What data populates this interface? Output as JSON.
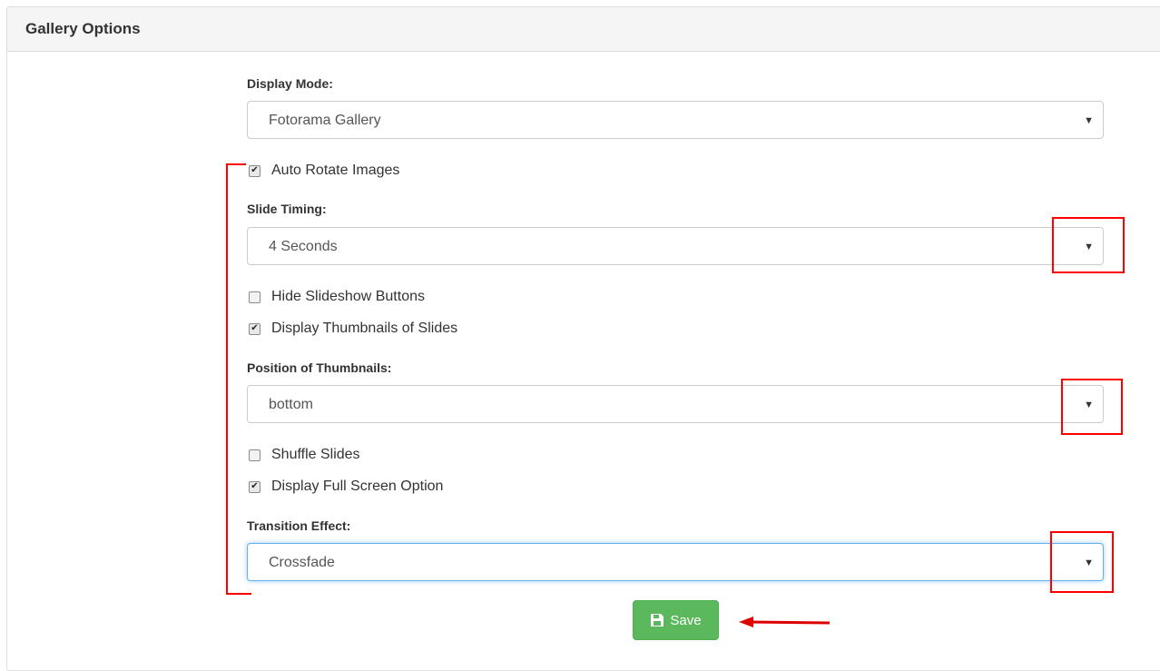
{
  "panel": {
    "title": "Gallery Options"
  },
  "display_mode": {
    "label": "Display Mode:",
    "value": "Fotorama Gallery"
  },
  "auto_rotate": {
    "label": "Auto Rotate Images",
    "checked": true
  },
  "slide_timing": {
    "label": "Slide Timing:",
    "value": "4 Seconds"
  },
  "hide_buttons": {
    "label": "Hide Slideshow Buttons",
    "checked": false
  },
  "display_thumbnails": {
    "label": "Display Thumbnails of Slides",
    "checked": true
  },
  "thumb_position": {
    "label": "Position of Thumbnails:",
    "value": "bottom"
  },
  "shuffle": {
    "label": "Shuffle Slides",
    "checked": false
  },
  "fullscreen": {
    "label": "Display Full Screen Option",
    "checked": true
  },
  "transition": {
    "label": "Transition Effect:",
    "value": "Crossfade"
  },
  "save": {
    "label": "Save",
    "icon": "floppy-disk-icon"
  },
  "caret_glyph": "▼",
  "check_glyph": "✔",
  "colors": {
    "save_bg": "#5cb85c",
    "annotation": "#ff0000",
    "focus": "#66afe9"
  }
}
